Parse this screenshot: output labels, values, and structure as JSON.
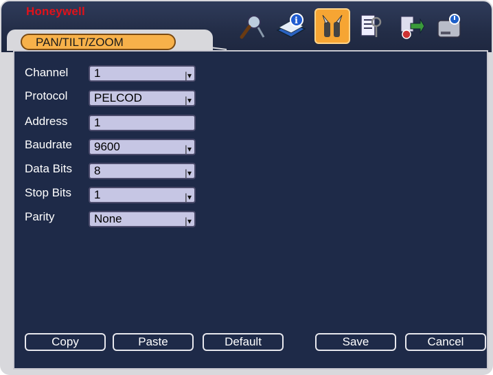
{
  "brand": {
    "logo_text": "Honeywell"
  },
  "tab": {
    "label": "PAN/TILT/ZOOM"
  },
  "toolbar": {
    "icons": [
      "search-icon",
      "info-icon",
      "tools-icon",
      "keys-icon",
      "transfer-icon",
      "disk-icon"
    ],
    "active_index": 2
  },
  "form": {
    "channel": {
      "label": "Channel",
      "value": "1"
    },
    "protocol": {
      "label": "Protocol",
      "value": "PELCOD"
    },
    "address": {
      "label": "Address",
      "value": "1"
    },
    "baudrate": {
      "label": "Baudrate",
      "value": "9600"
    },
    "data_bits": {
      "label": "Data Bits",
      "value": "8"
    },
    "stop_bits": {
      "label": "Stop Bits",
      "value": "1"
    },
    "parity": {
      "label": "Parity",
      "value": "None"
    }
  },
  "buttons": {
    "copy": "Copy",
    "paste": "Paste",
    "default": "Default",
    "save": "Save",
    "cancel": "Cancel"
  },
  "colors": {
    "panel_bg": "#1e2a48",
    "accent": "#f6a533",
    "brand_red": "#e0121a",
    "field_bg": "#c6c6e4"
  }
}
